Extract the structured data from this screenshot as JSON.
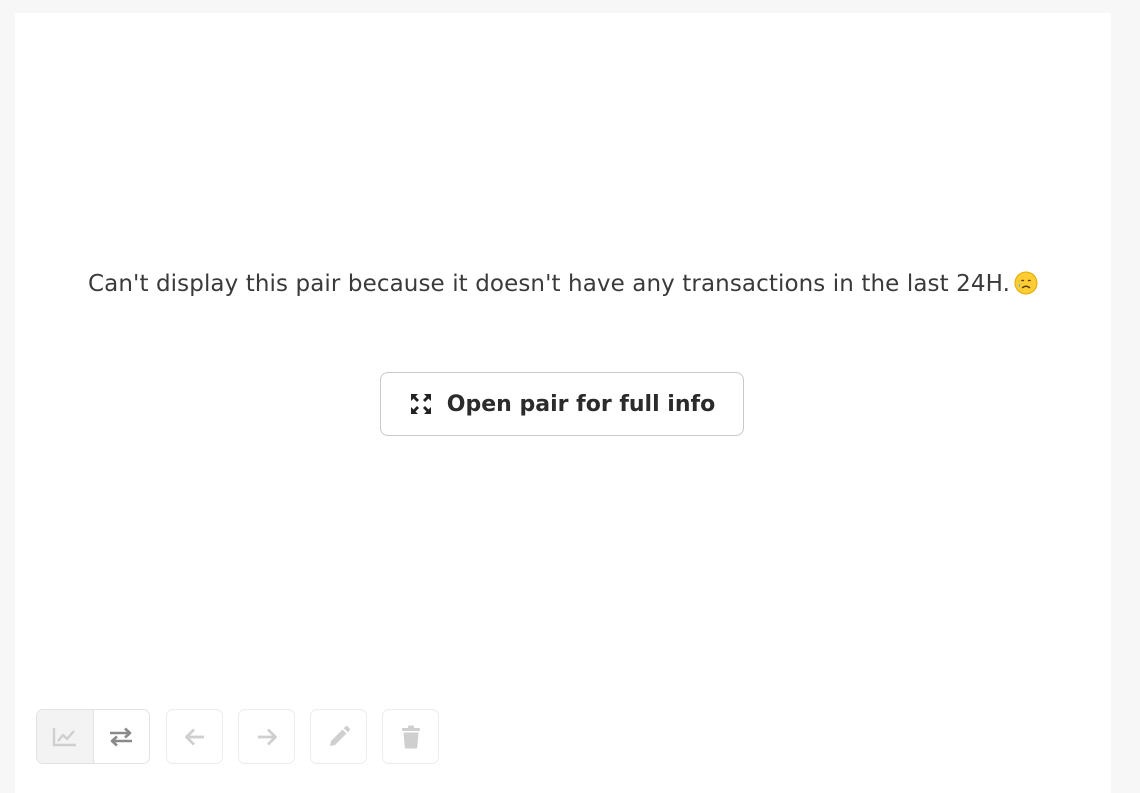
{
  "message": {
    "line": "Can't display this pair because it doesn't have any transactions in the last 24H.",
    "emoji_icon": "sad-sweat-face-icon"
  },
  "open_button": {
    "label": "Open pair for full info",
    "icon": "expand-arrows-icon"
  },
  "toolbar": {
    "view_toggle": [
      {
        "icon": "line-chart-icon",
        "active": true
      },
      {
        "icon": "swap-arrows-icon",
        "active": false
      }
    ],
    "actions": [
      {
        "icon": "arrow-left-icon"
      },
      {
        "icon": "arrow-right-icon"
      },
      {
        "icon": "pencil-icon"
      },
      {
        "icon": "trash-icon"
      }
    ]
  },
  "colors": {
    "background": "#f7f7f7",
    "panel": "#ffffff",
    "text": "#3a3a3a",
    "icon_muted": "#c8c8c8",
    "icon_dark": "#8a8a8a"
  }
}
